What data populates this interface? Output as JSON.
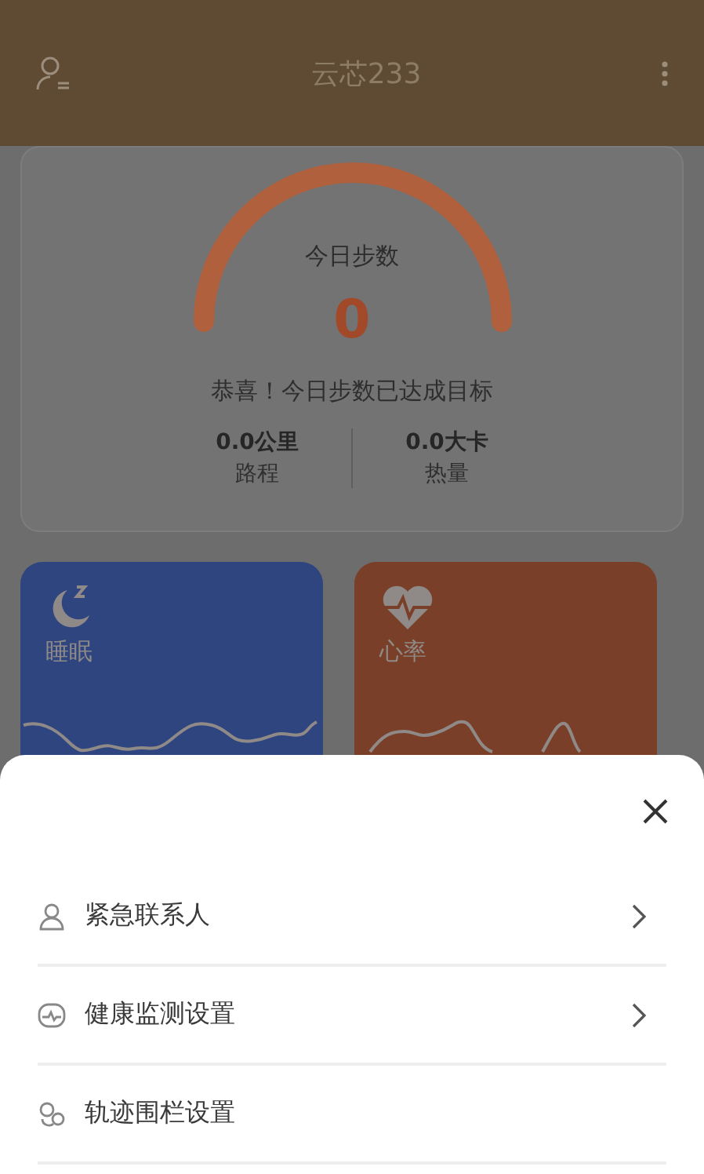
{
  "app_bar": {
    "title": "云芯233"
  },
  "steps_card": {
    "label": "今日步数",
    "steps": "0",
    "message": "恭喜！今日步数已达成目标",
    "stats": [
      {
        "value": "0.0公里",
        "label": "路程"
      },
      {
        "value": "0.0大卡",
        "label": "热量"
      }
    ]
  },
  "tiles": [
    {
      "kind": "sleep",
      "label": "睡眠"
    },
    {
      "kind": "heart",
      "label": "心率"
    }
  ],
  "sheet": {
    "items": [
      {
        "kind": "contact",
        "label": "紧急联系人",
        "chevron": true
      },
      {
        "kind": "health",
        "label": "健康监测设置",
        "chevron": true
      },
      {
        "kind": "fence",
        "label": "轨迹围栏设置",
        "chevron": false
      }
    ]
  }
}
